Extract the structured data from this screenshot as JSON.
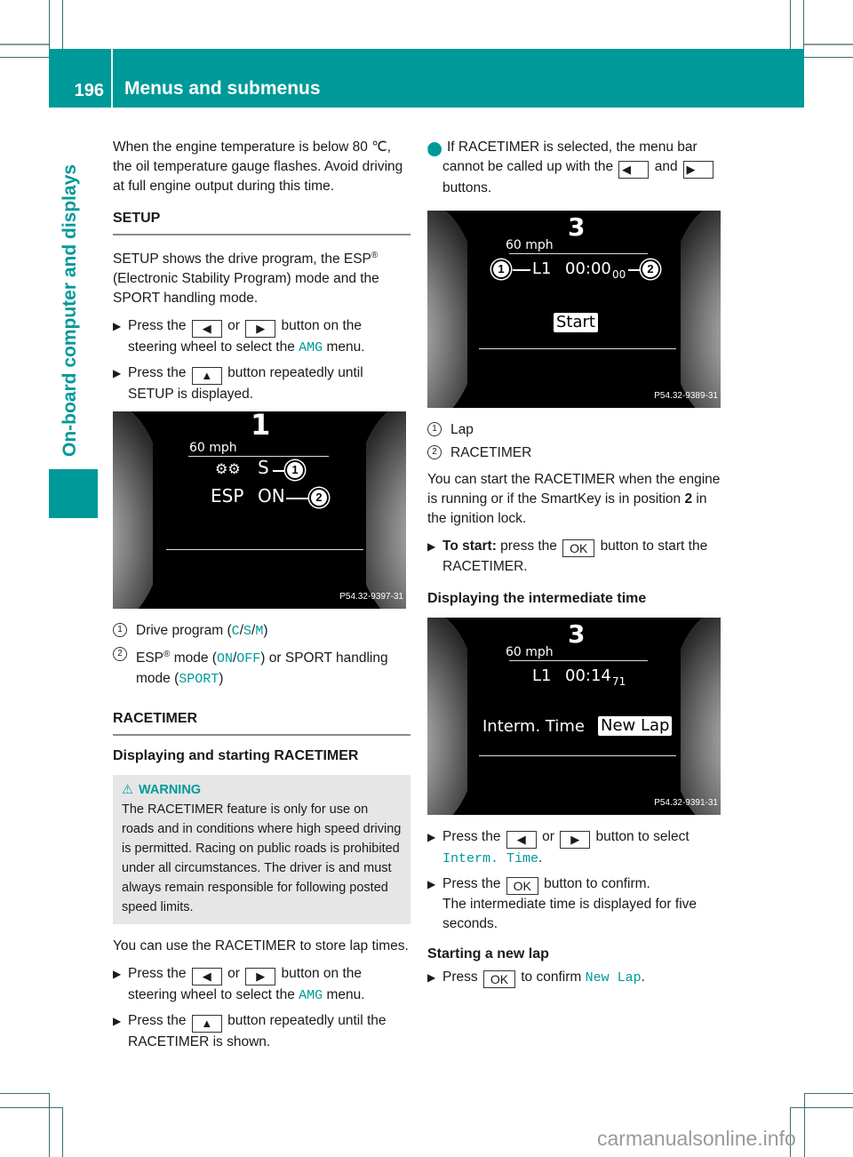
{
  "header": {
    "page_number": "196",
    "section_title": "Menus and submenus"
  },
  "side_tab": {
    "label": "On-board computer and displays"
  },
  "left_column": {
    "intro": "When the engine temperature is below 80 ℃, the oil temperature gauge flashes. Avoid driving at full engine output during this time.",
    "setup": {
      "heading": "SETUP",
      "description_pre": "SETUP shows the drive program, the ESP",
      "description_post": " (Electronic Stability Program) mode and the SPORT handling mode.",
      "registered": "®",
      "step1_pre": "Press the",
      "step1_or": "or",
      "step1_post": "button on the steering wheel to select the",
      "step1_menu": "AMG",
      "step1_end": "menu.",
      "step2_pre": "Press the",
      "step2_post": "button repeatedly until SETUP is displayed.",
      "display": {
        "speed": "60 mph",
        "gear": "1",
        "drive_program": "S",
        "esp_label": "ESP",
        "esp_value": "ON",
        "callout1": "1",
        "callout2": "2",
        "image_code": "P54.32-9397-31"
      },
      "legend": [
        {
          "num": "1",
          "text_pre": "Drive program (",
          "opts": [
            "C",
            "S",
            "M"
          ],
          "text_post": ")"
        },
        {
          "num": "2",
          "text_pre": "ESP",
          "text_mid": " mode (",
          "opts": [
            "ON",
            "OFF"
          ],
          "text_mid2": ") or SPORT handling mode (",
          "opt3": "SPORT",
          "text_post": ")"
        }
      ]
    },
    "racetimer": {
      "heading": "RACETIMER",
      "subheading": "Displaying and starting RACETIMER",
      "warning_title": "WARNING",
      "warning_text": "The RACETIMER feature is only for use on roads and in conditions where high speed driving is permitted. Racing on public roads is prohibited under all circumstances. The driver is and must always remain responsible for following posted speed limits.",
      "usage": "You can use the RACETIMER to store lap times.",
      "step1_pre": "Press the",
      "step1_or": "or",
      "step1_post": "button on the steering wheel to select the",
      "step1_menu": "AMG",
      "step1_end": "menu.",
      "step2_pre": "Press the",
      "step2_post": "button repeatedly until the RACETIMER is shown."
    }
  },
  "right_column": {
    "info_pre": "If RACETIMER is selected, the menu bar cannot be called up with the",
    "info_and": "and",
    "info_post": "buttons.",
    "display1": {
      "speed": "60 mph",
      "gear": "3",
      "lap": "L1",
      "time": "00:00",
      "time_small": "00",
      "button": "Start",
      "callout1": "1",
      "callout2": "2",
      "image_code": "P54.32-9389-31"
    },
    "legend": [
      {
        "num": "1",
        "text": "Lap"
      },
      {
        "num": "2",
        "text": "RACETIMER"
      }
    ],
    "start_para_pre": "You can start the RACETIMER when the engine is running or if the SmartKey is in position ",
    "start_para_bold": "2",
    "start_para_post": " in the ignition lock.",
    "to_start_label": "To start:",
    "to_start_pre": "press the",
    "to_start_post": "button to start the RACETIMER.",
    "intermediate_heading": "Displaying the intermediate time",
    "display2": {
      "speed": "60 mph",
      "gear": "3",
      "lap": "L1",
      "time": "00:14",
      "time_small": "71",
      "option1": "Interm. Time",
      "option2": "New Lap",
      "image_code": "P54.32-9391-31"
    },
    "step_select_pre": "Press the",
    "step_select_or": "or",
    "step_select_post": "button to select",
    "step_select_value": "Interm. Time",
    "step_confirm_pre": "Press the",
    "step_confirm_post": "button to confirm.",
    "step_confirm_result": "The intermediate time is displayed for five seconds.",
    "new_lap_heading": "Starting a new lap",
    "new_lap_pre": "Press",
    "new_lap_mid": "to confirm",
    "new_lap_value": "New Lap"
  },
  "keys": {
    "left": "◀",
    "right": "▶",
    "up": "▲",
    "ok": "OK"
  },
  "watermark": "carmanualsonline.info",
  "colors": {
    "accent": "#009999"
  }
}
